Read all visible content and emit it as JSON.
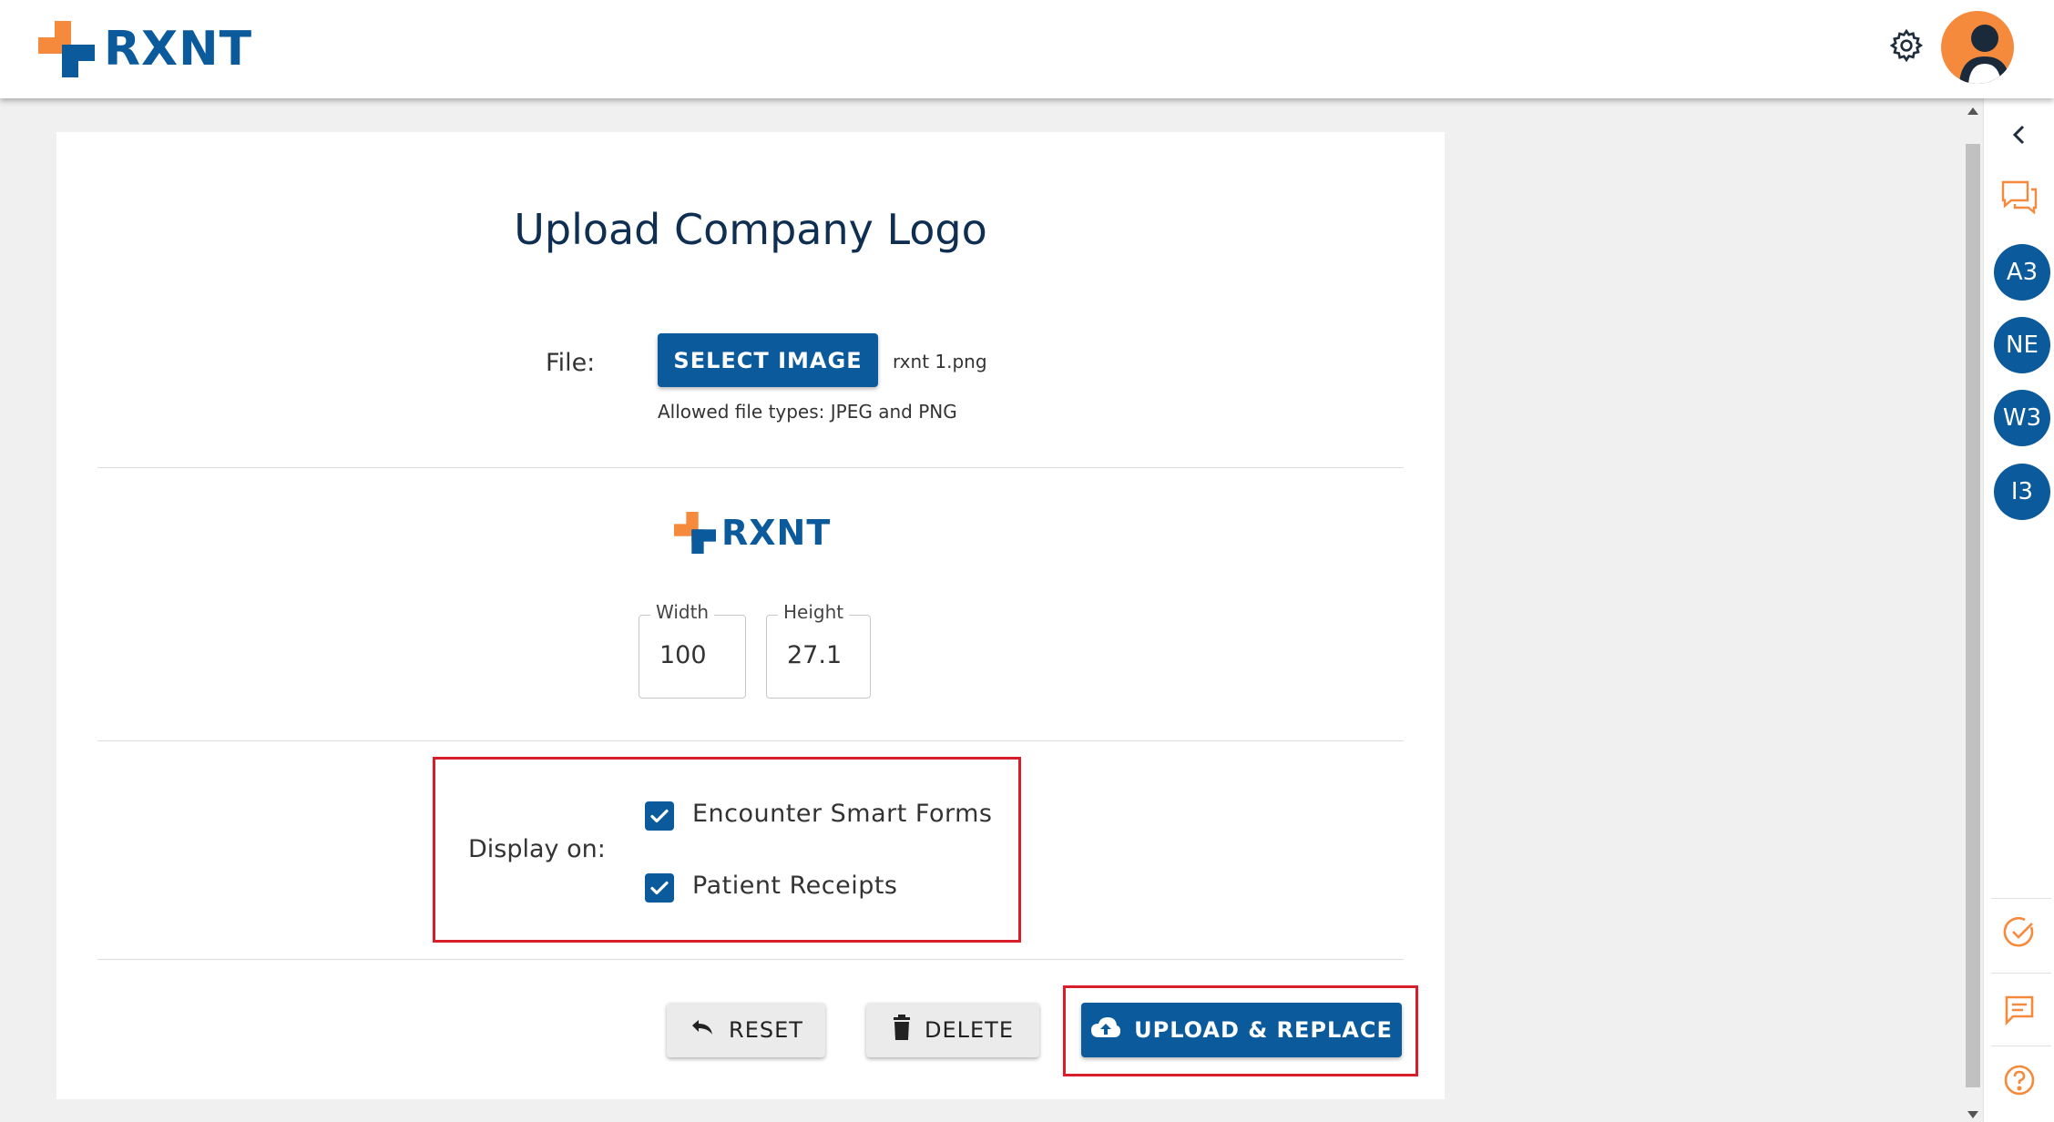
{
  "header": {
    "brand_name": "RXNT",
    "settings_icon": "gear-icon",
    "avatar_icon": "user-avatar-icon"
  },
  "colors": {
    "brand_blue": "#0b5a9c",
    "brand_orange": "#f58a3c",
    "highlight_red": "#d81e2a"
  },
  "card": {
    "title": "Upload Company Logo",
    "file_label": "File:",
    "select_image_label": "SELECT IMAGE",
    "file_name": "rxnt 1.png",
    "allowed_types": "Allowed file types: JPEG and PNG",
    "preview_brand": "RXNT",
    "width_label": "Width",
    "width_value": "100",
    "height_label": "Height",
    "height_value": "27.1",
    "display_on_label": "Display on:",
    "options": [
      {
        "label": "Encounter Smart Forms",
        "checked": true
      },
      {
        "label": "Patient Receipts",
        "checked": true
      }
    ],
    "reset_label": "RESET",
    "delete_label": "DELETE",
    "upload_label": "UPLOAD & REPLACE"
  },
  "rail": {
    "collapse_icon": "chevron-left-icon",
    "chat_icon": "chat-bubbles-icon",
    "avatars": [
      "A3",
      "NE",
      "W3",
      "I3"
    ],
    "tasks_icon": "check-circle-icon",
    "messages_icon": "message-icon",
    "help_icon": "help-icon"
  }
}
